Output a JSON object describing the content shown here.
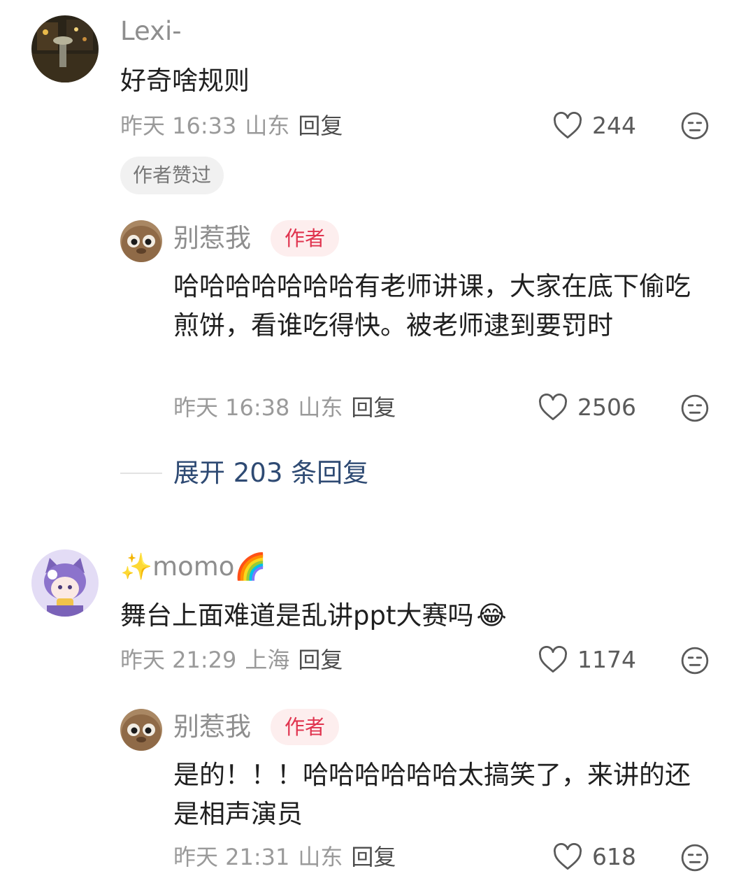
{
  "comments": [
    {
      "username": "Lexi-",
      "text": "好奇啥规则",
      "time": "昨天 16:33",
      "location": "山东",
      "reply_label": "回复",
      "likes": "244",
      "author_liked_chip": "作者赞过",
      "replies": [
        {
          "username": "别惹我",
          "badge": "作者",
          "text": "哈哈哈哈哈哈哈有老师讲课，大家在底下偷吃煎饼，看谁吃得快。被老师逮到要罚时",
          "time": "昨天 16:38",
          "location": "山东",
          "reply_label": "回复",
          "likes": "2506"
        }
      ],
      "expand_label": "展开 203 条回复"
    },
    {
      "username": "✨momo🌈",
      "text": "舞台上面难道是乱讲ppt大赛吗",
      "emoji": "😂",
      "time": "昨天 21:29",
      "location": "上海",
      "reply_label": "回复",
      "likes": "1174",
      "replies": [
        {
          "username": "别惹我",
          "badge": "作者",
          "text": "是的！！！哈哈哈哈哈哈太搞笑了，来讲的还是相声演员",
          "time": "昨天 21:31",
          "location": "山东",
          "reply_label": "回复",
          "likes": "618"
        }
      ]
    }
  ],
  "icons": {
    "like": "heart-outline-icon",
    "dislike": "unamused-face-icon"
  },
  "colors": {
    "author_badge_text": "#e0344f",
    "author_badge_bg": "#fdeeee",
    "expand_link": "#2e4a73",
    "meta_text": "#9a9a9a"
  }
}
